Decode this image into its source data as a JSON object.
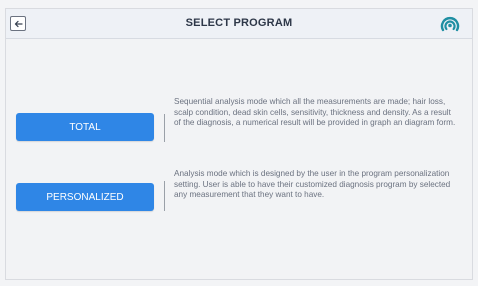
{
  "header": {
    "title": "SELECT PROGRAM",
    "back_icon": "arrow-left-icon",
    "logo_icon": "brand-logo-icon"
  },
  "programs": [
    {
      "button_label": "TOTAL",
      "description": "Sequential analysis mode which all the measurements are made; hair loss, scalp condition, dead skin cells, sensitivity, thickness and density. As a result of the diagnosis, a numerical result will be provided in graph an diagram form."
    },
    {
      "button_label": "PERSONALIZED",
      "description": "Analysis mode which is designed by the user in the program personalization setting. User is able to have their customized diagnosis program by selected any measurement that they want to have."
    }
  ],
  "colors": {
    "button_blue": "#2f86e6",
    "logo_teal": "#1f8fa3",
    "text_gray": "#6b7280"
  }
}
